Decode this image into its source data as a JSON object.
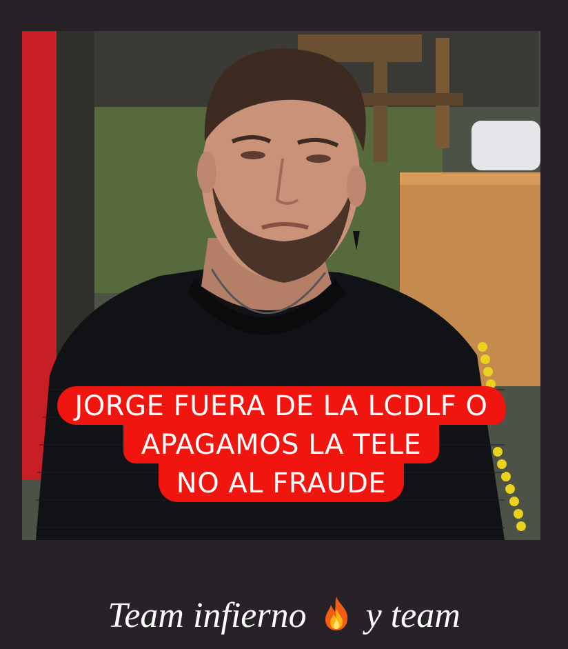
{
  "caption": {
    "line1": "JORGE FUERA DE LA LCDLF O",
    "line2": "APAGAMOS LA TELE",
    "line3": "NO AL FRAUDE"
  },
  "footer": {
    "text_before": "Team infierno",
    "emoji_icon": "fire-emoji-icon",
    "text_after": "y team"
  },
  "colors": {
    "background": "#262227",
    "caption_bg": "#f0150f",
    "caption_text": "#ffffff",
    "footer_text": "#ffffff"
  }
}
